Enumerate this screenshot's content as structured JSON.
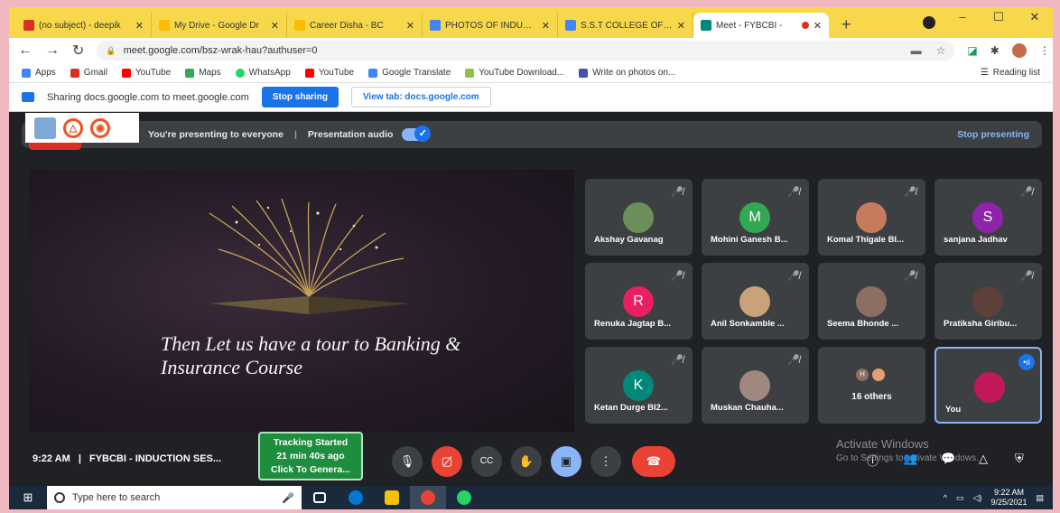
{
  "browser": {
    "tabs": [
      {
        "label": "(no subject) - deepik",
        "favicon_color": "#d93025"
      },
      {
        "label": "My Drive - Google Dr",
        "favicon_color": "#fbbc04"
      },
      {
        "label": "Career Disha - BC",
        "favicon_color": "#fbbc04"
      },
      {
        "label": "PHOTOS OF INDUCTI",
        "favicon_color": "#4285f4"
      },
      {
        "label": "S.S.T COLLEGE OF AR",
        "favicon_color": "#4285f4"
      },
      {
        "label": "Meet - FYBCBI -",
        "favicon_color": "#00897b"
      }
    ],
    "new_tab": "+",
    "window_controls": [
      "–",
      "☐",
      "✕"
    ],
    "nav": {
      "back": "←",
      "forward": "→",
      "reload": "↻"
    },
    "url": "meet.google.com/bsz-wrak-hau?authuser=0",
    "bookmarks": [
      {
        "label": "Apps",
        "color": "#4285f4"
      },
      {
        "label": "Gmail",
        "color": "#d93025"
      },
      {
        "label": "YouTube",
        "color": "#ff0000"
      },
      {
        "label": "Maps",
        "color": "#34a853"
      },
      {
        "label": "WhatsApp",
        "color": "#25d366"
      },
      {
        "label": "YouTube",
        "color": "#ff0000"
      },
      {
        "label": "Google Translate",
        "color": "#4285f4"
      },
      {
        "label": "YouTube Download...",
        "color": "#8bc34a"
      },
      {
        "label": "Write on photos on...",
        "color": "#3f51b5"
      }
    ],
    "reading_list": "Reading list"
  },
  "share_bar": {
    "text": "Sharing docs.google.com to meet.google.com",
    "stop_sharing": "Stop sharing",
    "view_tab": "View tab: docs.google.com"
  },
  "presenting_bar": {
    "text": "You're presenting to everyone",
    "separator": "|",
    "audio": "Presentation audio",
    "stop": "Stop presenting"
  },
  "slide": {
    "line1": "Then Let us have a tour to Banking &",
    "line2": "Insurance Course"
  },
  "participants": [
    {
      "name": "Akshay Gavanag",
      "initial": "",
      "color": "#6b8e5a"
    },
    {
      "name": "Mohini Ganesh B...",
      "initial": "M",
      "color": "#33a853"
    },
    {
      "name": "Komal Thigale BI...",
      "initial": "",
      "color": "#c77b5e"
    },
    {
      "name": "sanjana Jadhav",
      "initial": "S",
      "color": "#8e24aa"
    },
    {
      "name": "Renuka Jagtap B...",
      "initial": "R",
      "color": "#e91e63"
    },
    {
      "name": "Anil Sonkamble ...",
      "initial": "",
      "color": "#c9a27a"
    },
    {
      "name": "Seema Bhonde ...",
      "initial": "",
      "color": "#8d6e63"
    },
    {
      "name": "Pratiksha Giribu...",
      "initial": "",
      "color": "#5d4037"
    },
    {
      "name": "Ketan Durge BI2...",
      "initial": "K",
      "color": "#00897b"
    },
    {
      "name": "Muskan Chauha...",
      "initial": "",
      "color": "#a1887f"
    },
    {
      "name": "16 others",
      "initial": "H",
      "color": "#8d6e63"
    },
    {
      "name": "You",
      "initial": "",
      "color": "#c2185b"
    }
  ],
  "controls": {
    "time": "9:22 AM",
    "separator": "|",
    "meeting": "FYBCBI - INDUCTION SES...",
    "tracking": [
      "Tracking Started",
      "21 min 40s ago",
      "Click To Genera..."
    ]
  },
  "watermark": {
    "title": "Activate Windows",
    "sub": "Go to Settings to activate Windows."
  },
  "taskbar": {
    "search_placeholder": "Type here to search",
    "time": "9:22 AM",
    "date": "9/25/2021"
  }
}
